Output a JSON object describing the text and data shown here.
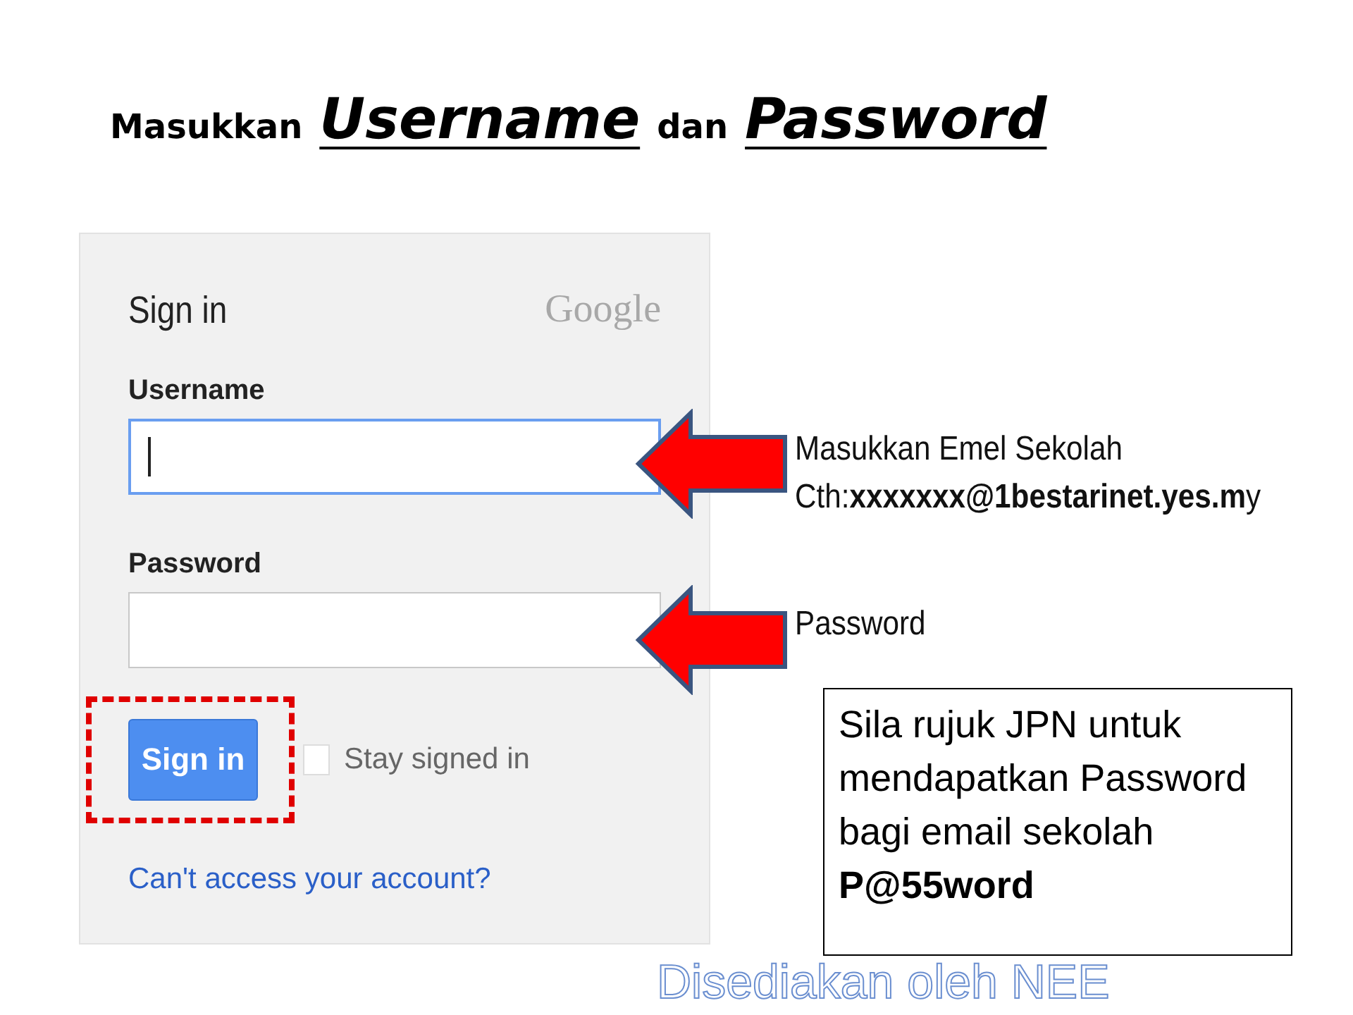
{
  "title": {
    "words": [
      {
        "text": "Masukkan",
        "kind": "plain"
      },
      {
        "text": "Username",
        "kind": "emphasis"
      },
      {
        "text": "dan",
        "kind": "plain"
      },
      {
        "text": "Password",
        "kind": "emphasis"
      }
    ]
  },
  "sign_in": {
    "heading": "Sign in",
    "brand": "Google",
    "fields": [
      {
        "label": "Username",
        "focused": true
      },
      {
        "label": "Password",
        "focused": false
      }
    ],
    "button": "Sign in",
    "button_highlighted": true,
    "stay_signed_in": {
      "label": "Stay signed in",
      "checked": false
    },
    "help_link": "Can't access your account?"
  },
  "annotations": [
    {
      "lines": [
        "Masukkan Emel Sekolah",
        "Cth:**xxxxxxx@1bestarinet.yes.m**y"
      ]
    },
    {
      "lines": [
        "Password"
      ]
    }
  ],
  "note": {
    "text": "Sila rujuk JPN untuk mendapatkan Password bagi email sekolah",
    "example": "P@55word"
  },
  "footer": "Disediakan oleh NEE"
}
